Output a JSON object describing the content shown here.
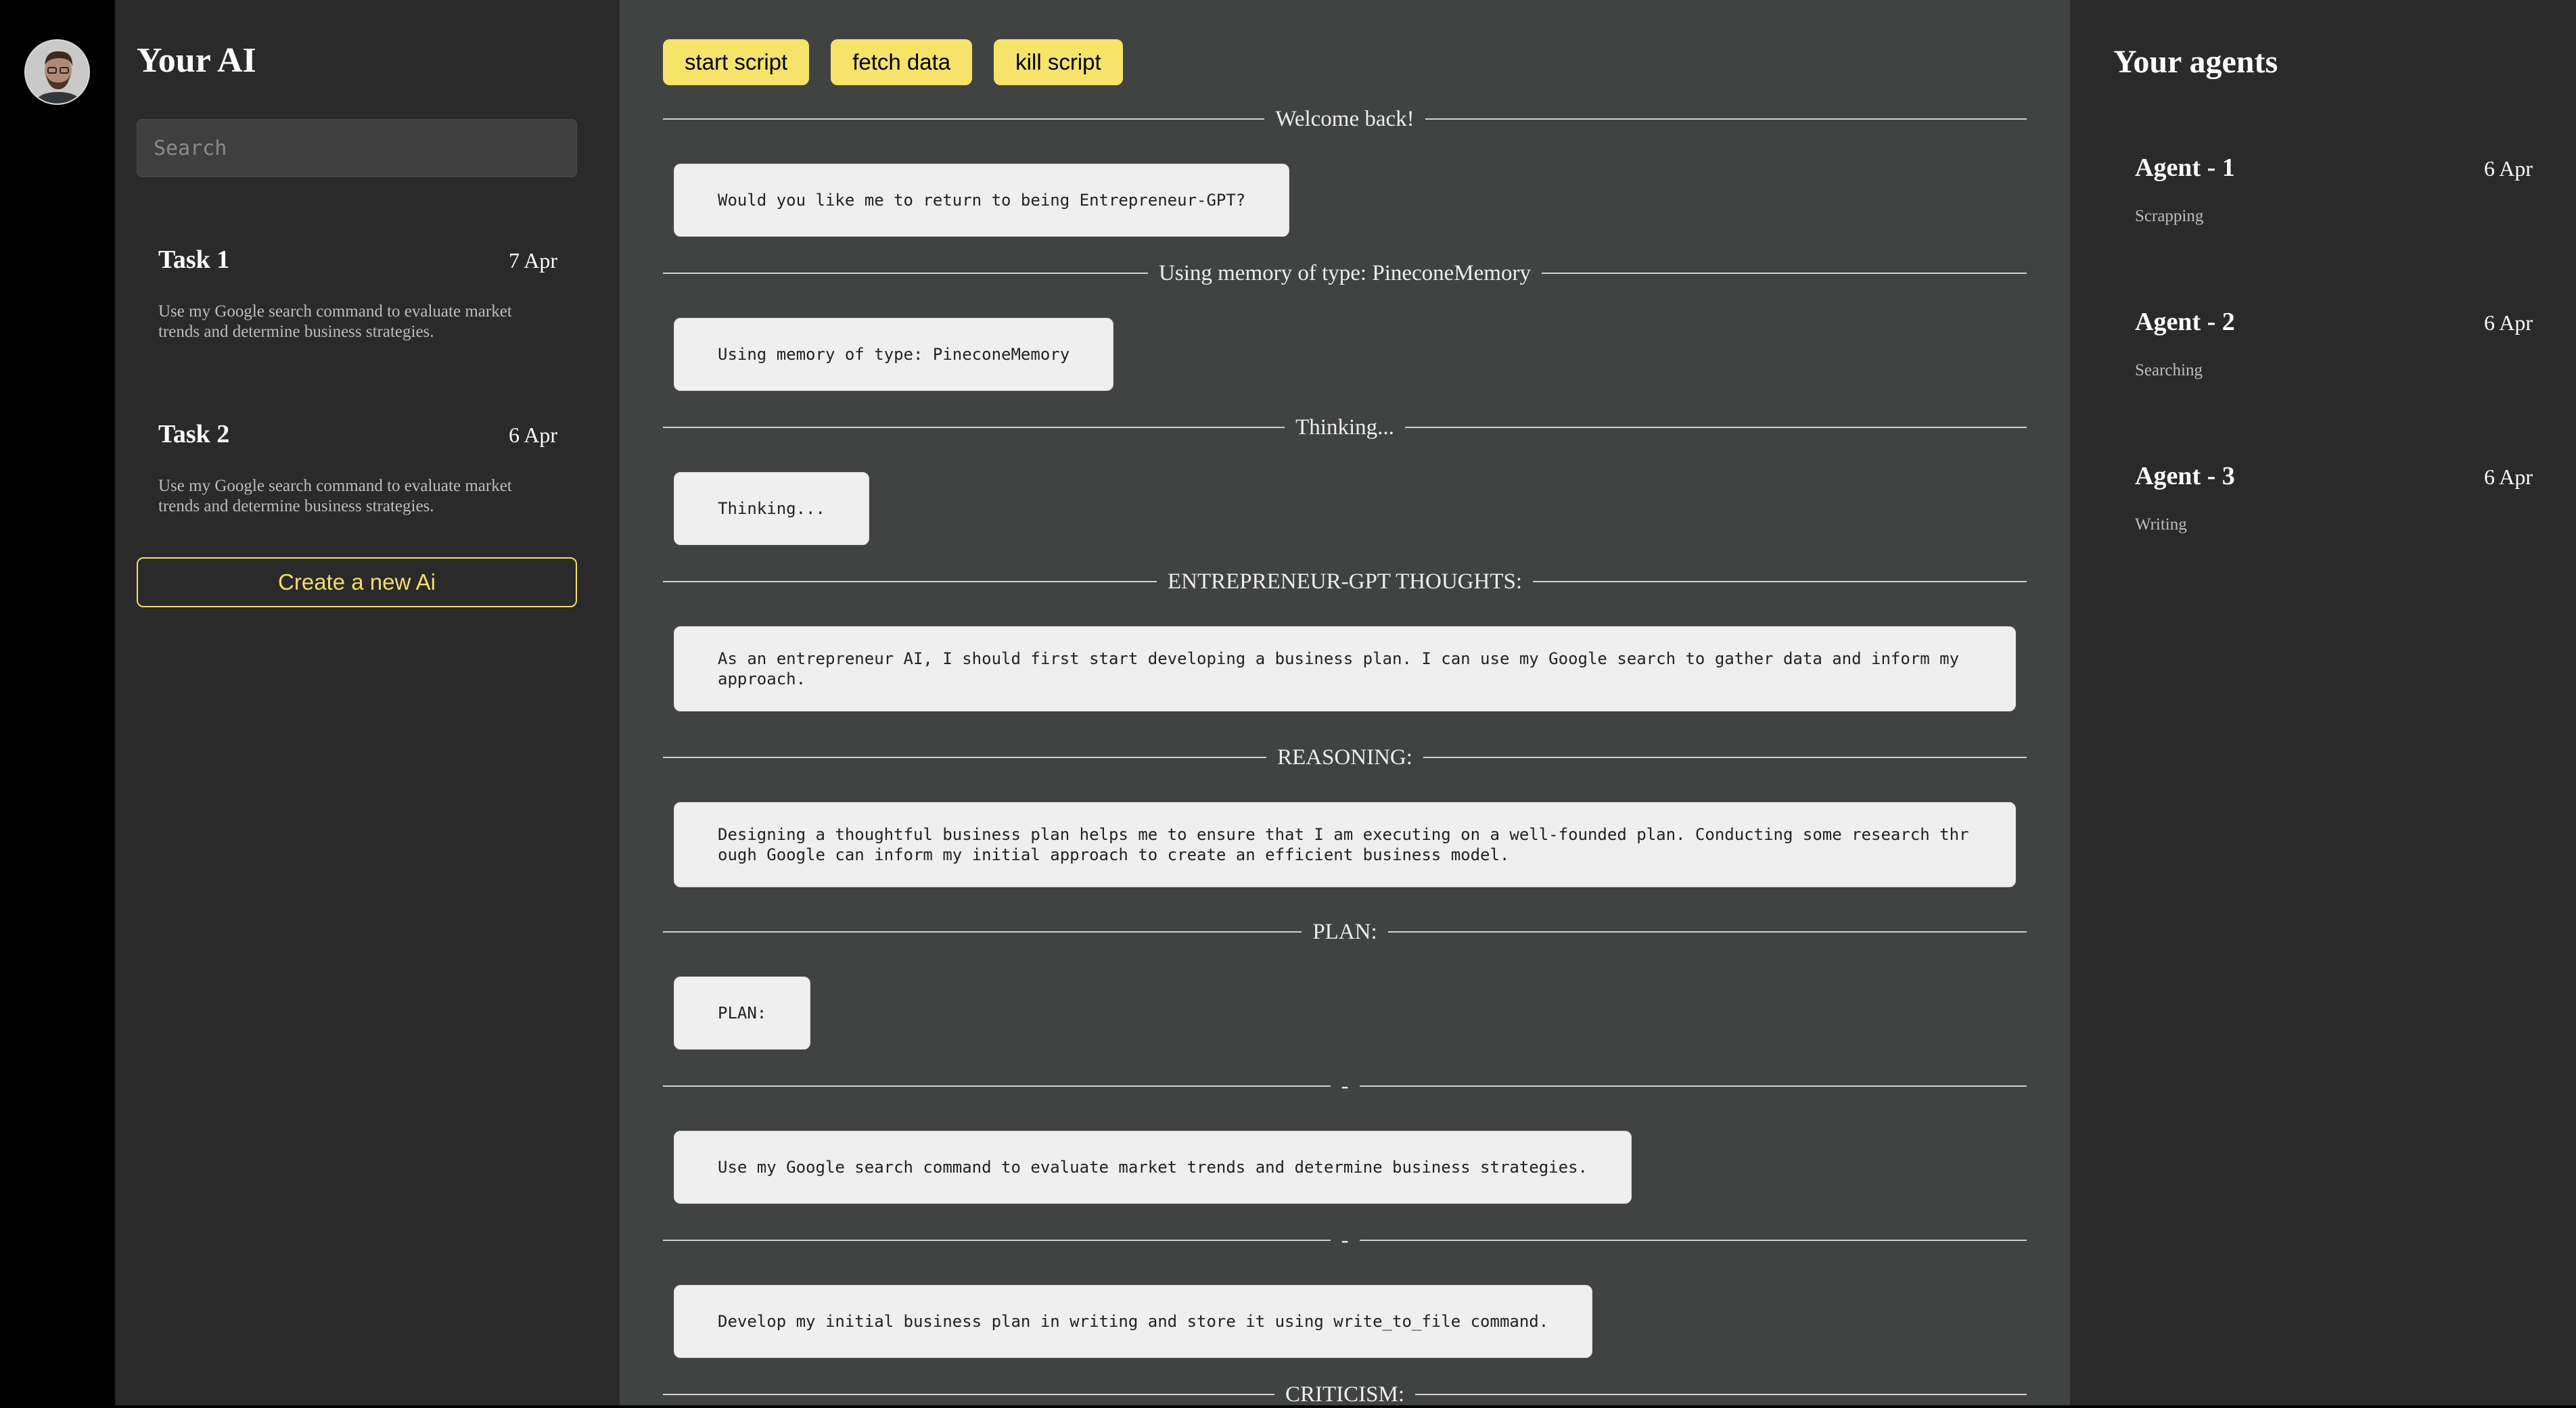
{
  "left": {
    "title": "Your AI",
    "search_placeholder": "Search",
    "tasks": [
      {
        "title": "Task 1",
        "date": "7 Apr",
        "desc": "Use my Google search command to evaluate market trends and determine business strategies."
      },
      {
        "title": "Task 2",
        "date": "6 Apr",
        "desc": "Use my Google search command to evaluate market trends and determine business strategies."
      }
    ],
    "create_label": "Create a new Ai"
  },
  "toolbar": {
    "start": "start script",
    "fetch": "fetch data",
    "kill": "kill script"
  },
  "feed": [
    {
      "heading": "Welcome back!",
      "text": "Would you like me to return to being Entrepreneur-GPT?"
    },
    {
      "heading": "Using memory of type: PineconeMemory",
      "text": "Using memory of type: PineconeMemory"
    },
    {
      "heading": "Thinking...",
      "text": "Thinking..."
    },
    {
      "heading": "ENTREPRENEUR-GPT THOUGHTS:",
      "text": "As an entrepreneur AI, I should first start developing a business plan. I can use my Google search to gather data and inform my approach."
    },
    {
      "heading": "REASONING:",
      "text": "Designing a thoughtful business plan helps me to ensure that I am executing on a well-founded plan. Conducting some research through Google can inform my initial approach to create an efficient business model."
    },
    {
      "heading": "PLAN:",
      "text": "PLAN:"
    },
    {
      "heading": "-",
      "text": "Use my Google search command to evaluate market trends and determine business strategies."
    },
    {
      "heading": "-",
      "text": "Develop my initial business plan in writing and store it using write_to_file command."
    },
    {
      "heading": "CRITICISM:",
      "text": ""
    }
  ],
  "right": {
    "title": "Your agents",
    "agents": [
      {
        "name": "Agent - 1",
        "date": "6 Apr",
        "status": "Scrapping"
      },
      {
        "name": "Agent - 2",
        "date": "6 Apr",
        "status": "Searching"
      },
      {
        "name": "Agent - 3",
        "date": "6 Apr",
        "status": "Writing"
      }
    ]
  },
  "colors": {
    "accent": "#f5e36a",
    "center_bg": "#414343",
    "panel_bg": "#2a2a2a",
    "bubble_bg": "#efefef"
  }
}
